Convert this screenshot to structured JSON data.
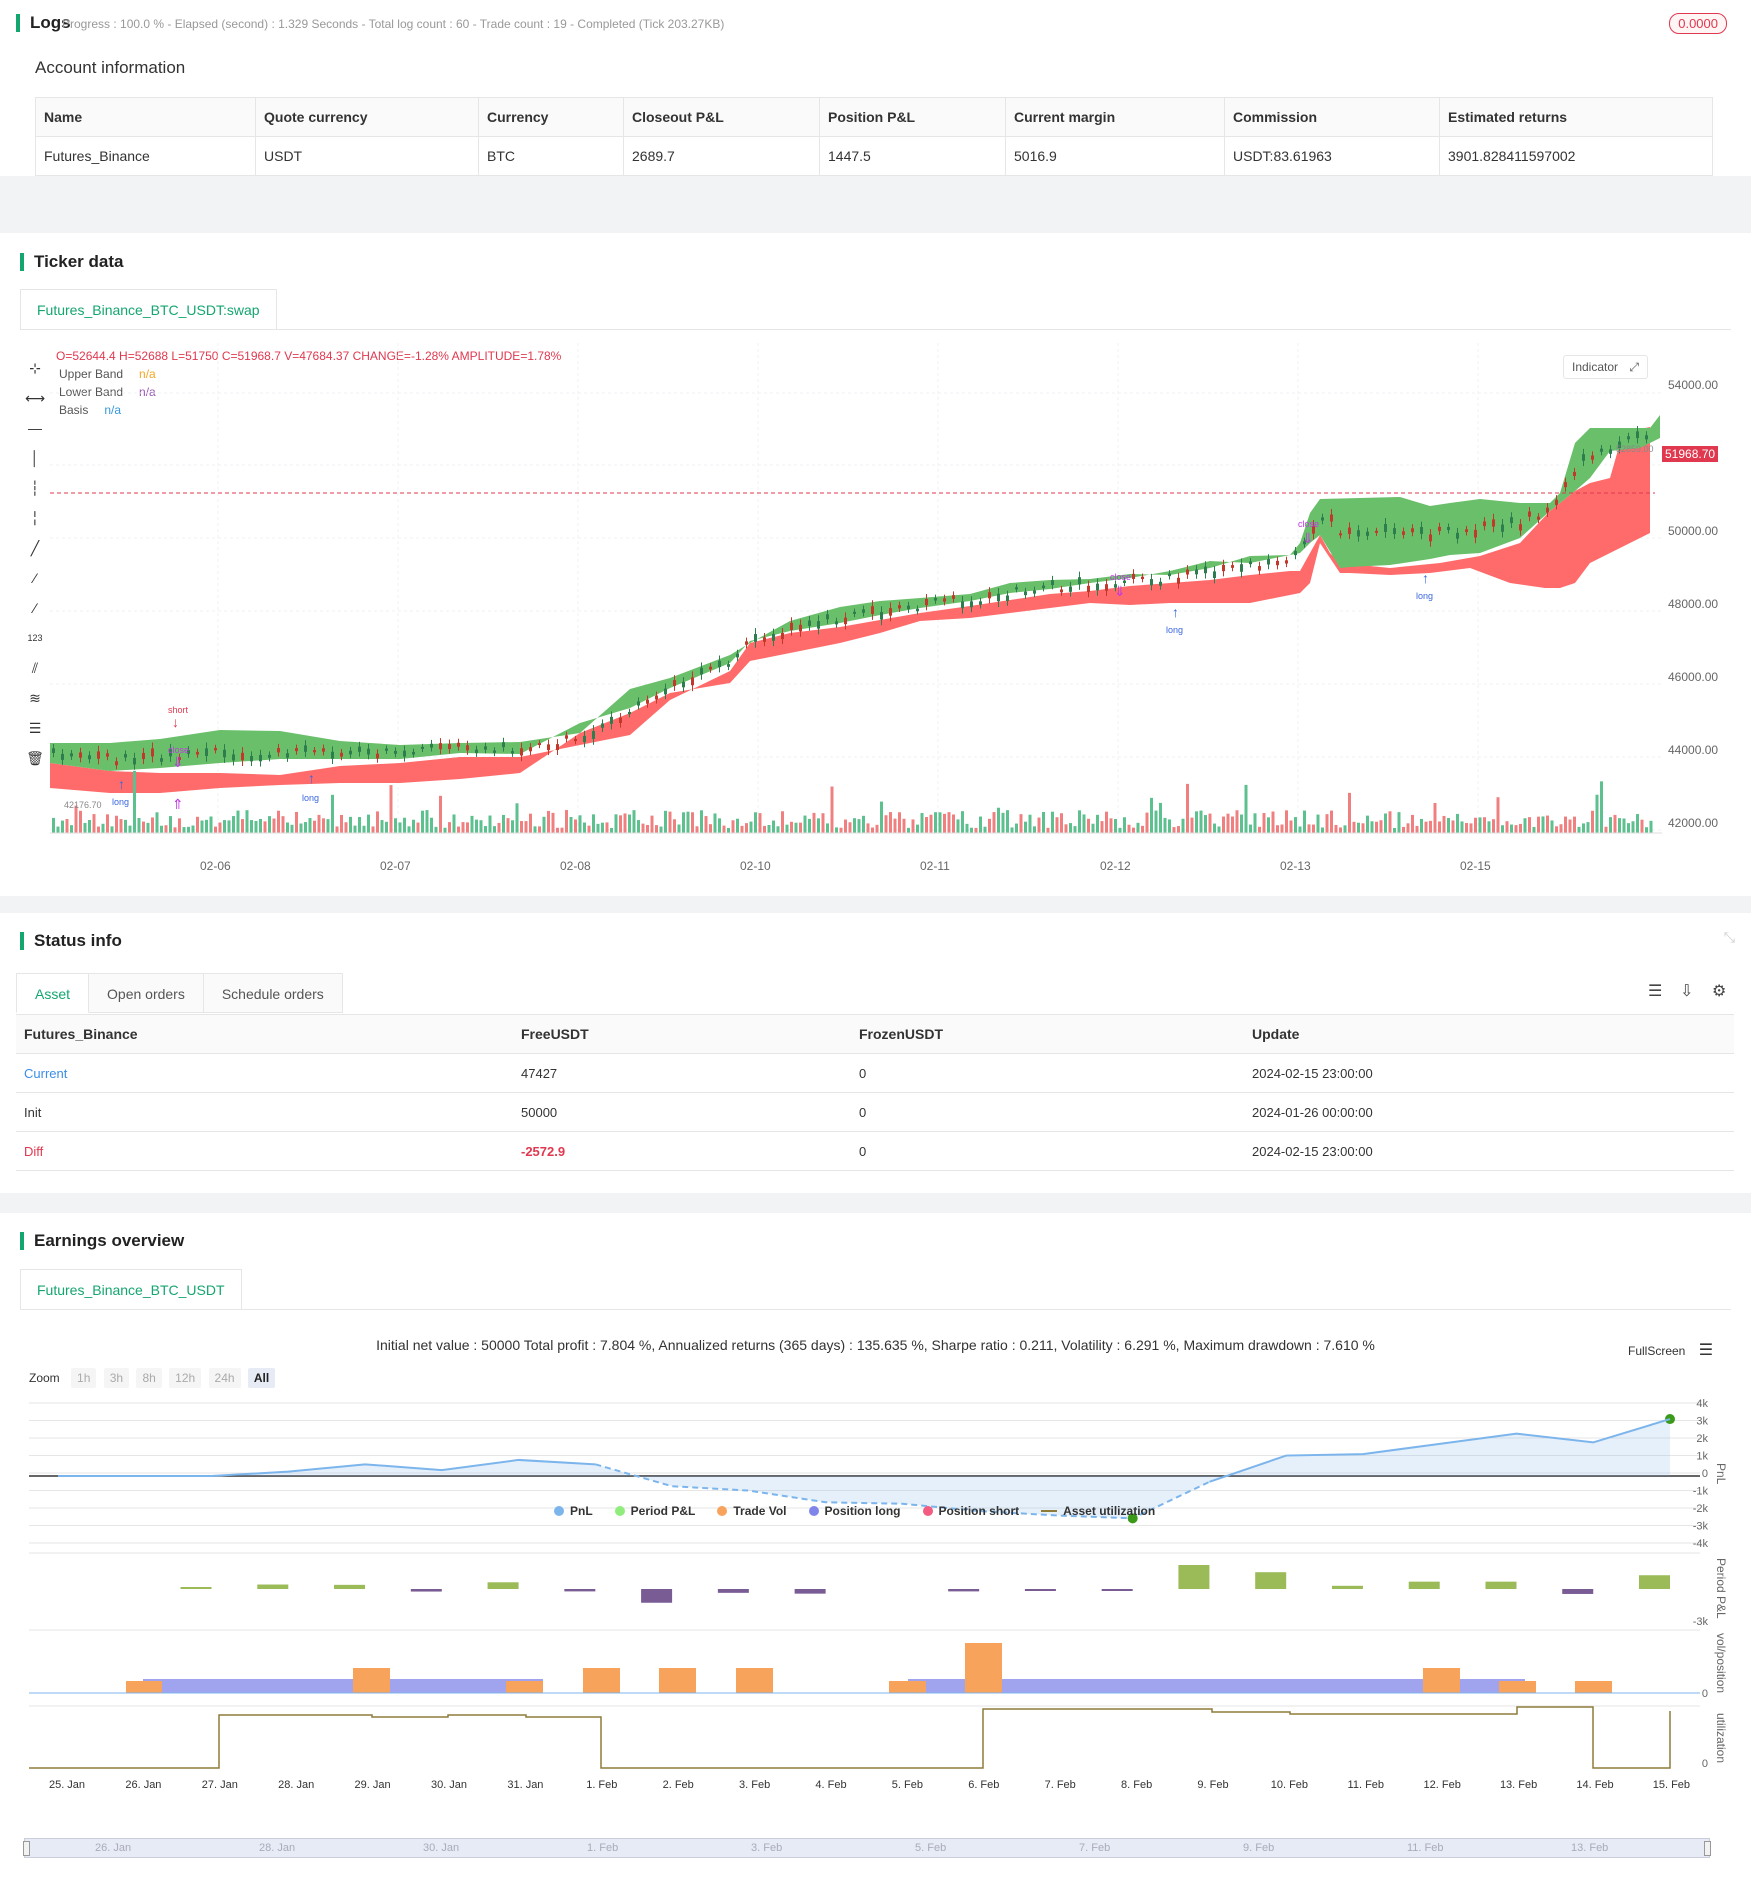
{
  "logs": {
    "title": "Logs",
    "status": "Progress : 100.0 % - Elapsed (second) : 1.329 Seconds - Total log count : 60 - Trade count : 19 - Completed (Tick 203.27KB)",
    "badge": "0.0000"
  },
  "account": {
    "title": "Account information",
    "headers": [
      "Name",
      "Quote currency",
      "Currency",
      "Closeout P&L",
      "Position P&L",
      "Current margin",
      "Commission",
      "Estimated returns"
    ],
    "row": [
      "Futures_Binance",
      "USDT",
      "BTC",
      "2689.7",
      "1447.5",
      "5016.9",
      "USDT:83.61963",
      "3901.828411597002"
    ]
  },
  "ticker": {
    "title": "Ticker data",
    "tab": "Futures_Binance_BTC_USDT:swap",
    "ohlc": "O=52644.4 H=52688 L=51750 C=51968.7 V=47684.37 CHANGE=-1.28% AMPLITUDE=1.78%",
    "legend": [
      {
        "name": "Upper Band",
        "value": "n/a",
        "color": "#f5a623"
      },
      {
        "name": "Lower Band",
        "value": "n/a",
        "color": "#9b59b6"
      },
      {
        "name": "Basis",
        "value": "n/a",
        "color": "#3498db"
      }
    ],
    "indicator_btn": "Indicator",
    "price_labels": [
      "54000.00",
      "52000.00",
      "50000.00",
      "48000.00",
      "46000.00",
      "44000.00",
      "42000.00"
    ],
    "current_price": "51968.70",
    "high_label": "52859.00",
    "low_label": "42176.70",
    "date_labels": [
      "02-06",
      "02-07",
      "02-08",
      "02-10",
      "02-11",
      "02-12",
      "02-13",
      "02-15"
    ],
    "markers": {
      "short": "short",
      "close": "close",
      "long": "long"
    }
  },
  "status": {
    "title": "Status info",
    "tabs": [
      "Asset",
      "Open orders",
      "Schedule orders"
    ],
    "headers": [
      "Futures_Binance",
      "FreeUSDT",
      "FrozenUSDT",
      "Update"
    ],
    "rows": [
      [
        "Current",
        "47427",
        "0",
        "2024-02-15 23:00:00"
      ],
      [
        "Init",
        "50000",
        "0",
        "2024-01-26 00:00:00"
      ],
      [
        "Diff",
        "-2572.9",
        "0",
        "2024-02-15 23:00:00"
      ]
    ]
  },
  "earnings": {
    "title": "Earnings overview",
    "tab": "Futures_Binance_BTC_USDT",
    "summary": "Initial net value : 50000 Total profit : 7.804 %, Annualized returns (365 days) : 135.635 %, Sharpe ratio : 0.211, Volatility : 6.291 %, Maximum drawdown : 7.610 %",
    "fullscreen": "FullScreen",
    "zoom_label": "Zoom",
    "zoom_options": [
      "1h",
      "3h",
      "8h",
      "12h",
      "24h",
      "All"
    ],
    "pnl_ticks": [
      "4k",
      "3k",
      "2k",
      "1k",
      "0",
      "-1k",
      "-2k",
      "-3k",
      "-4k"
    ],
    "period_tick": "-3k",
    "vol_tick": "0",
    "util_tick": "0",
    "axis_titles": [
      "PnL",
      "Period P&L",
      "vol/position",
      "utilization"
    ],
    "x_labels": [
      "25. Jan",
      "26. Jan",
      "27. Jan",
      "28. Jan",
      "29. Jan",
      "30. Jan",
      "31. Jan",
      "1. Feb",
      "2. Feb",
      "3. Feb",
      "4. Feb",
      "5. Feb",
      "6. Feb",
      "7. Feb",
      "8. Feb",
      "9. Feb",
      "10. Feb",
      "11. Feb",
      "12. Feb",
      "13. Feb",
      "14. Feb",
      "15. Feb"
    ],
    "nav_labels": [
      "26. Jan",
      "28. Jan",
      "30. Jan",
      "1. Feb",
      "3. Feb",
      "5. Feb",
      "7. Feb",
      "9. Feb",
      "11. Feb",
      "13. Feb"
    ],
    "legend": [
      {
        "name": "PnL",
        "color": "#7cb5ec"
      },
      {
        "name": "Period P&L",
        "color": "#90ed7d"
      },
      {
        "name": "Trade Vol",
        "color": "#f7a35c"
      },
      {
        "name": "Position long",
        "color": "#8085e9"
      },
      {
        "name": "Position short",
        "color": "#f15c80"
      },
      {
        "name": "Asset utilization",
        "color": "#8d7b3a"
      }
    ]
  },
  "chart_data": {
    "type": "line",
    "title": "",
    "series": [
      {
        "name": "PnL",
        "x": [
          "25. Jan",
          "26. Jan",
          "27. Jan",
          "28. Jan",
          "29. Jan",
          "30. Jan",
          "31. Jan",
          "1. Feb",
          "2. Feb",
          "3. Feb",
          "4. Feb",
          "5. Feb",
          "6. Feb",
          "7. Feb",
          "8. Feb",
          "9. Feb",
          "10. Feb",
          "11. Feb",
          "12. Feb",
          "13. Feb",
          "14. Feb",
          "15. Feb"
        ],
        "values": [
          0,
          0,
          0,
          300,
          800,
          400,
          1100,
          800,
          -700,
          -1000,
          -1800,
          -1900,
          -2400,
          -2700,
          -2900,
          -400,
          1400,
          1500,
          2200,
          2900,
          2300,
          3900
        ]
      },
      {
        "name": "Period P&L",
        "values": [
          0,
          0,
          40,
          280,
          260,
          -160,
          420,
          -150,
          -860,
          -240,
          -290,
          0,
          -150,
          -60,
          -60,
          1500,
          1050,
          200,
          460,
          460,
          -310,
          860
        ]
      }
    ],
    "ylim": [
      -4000,
      4000
    ]
  }
}
